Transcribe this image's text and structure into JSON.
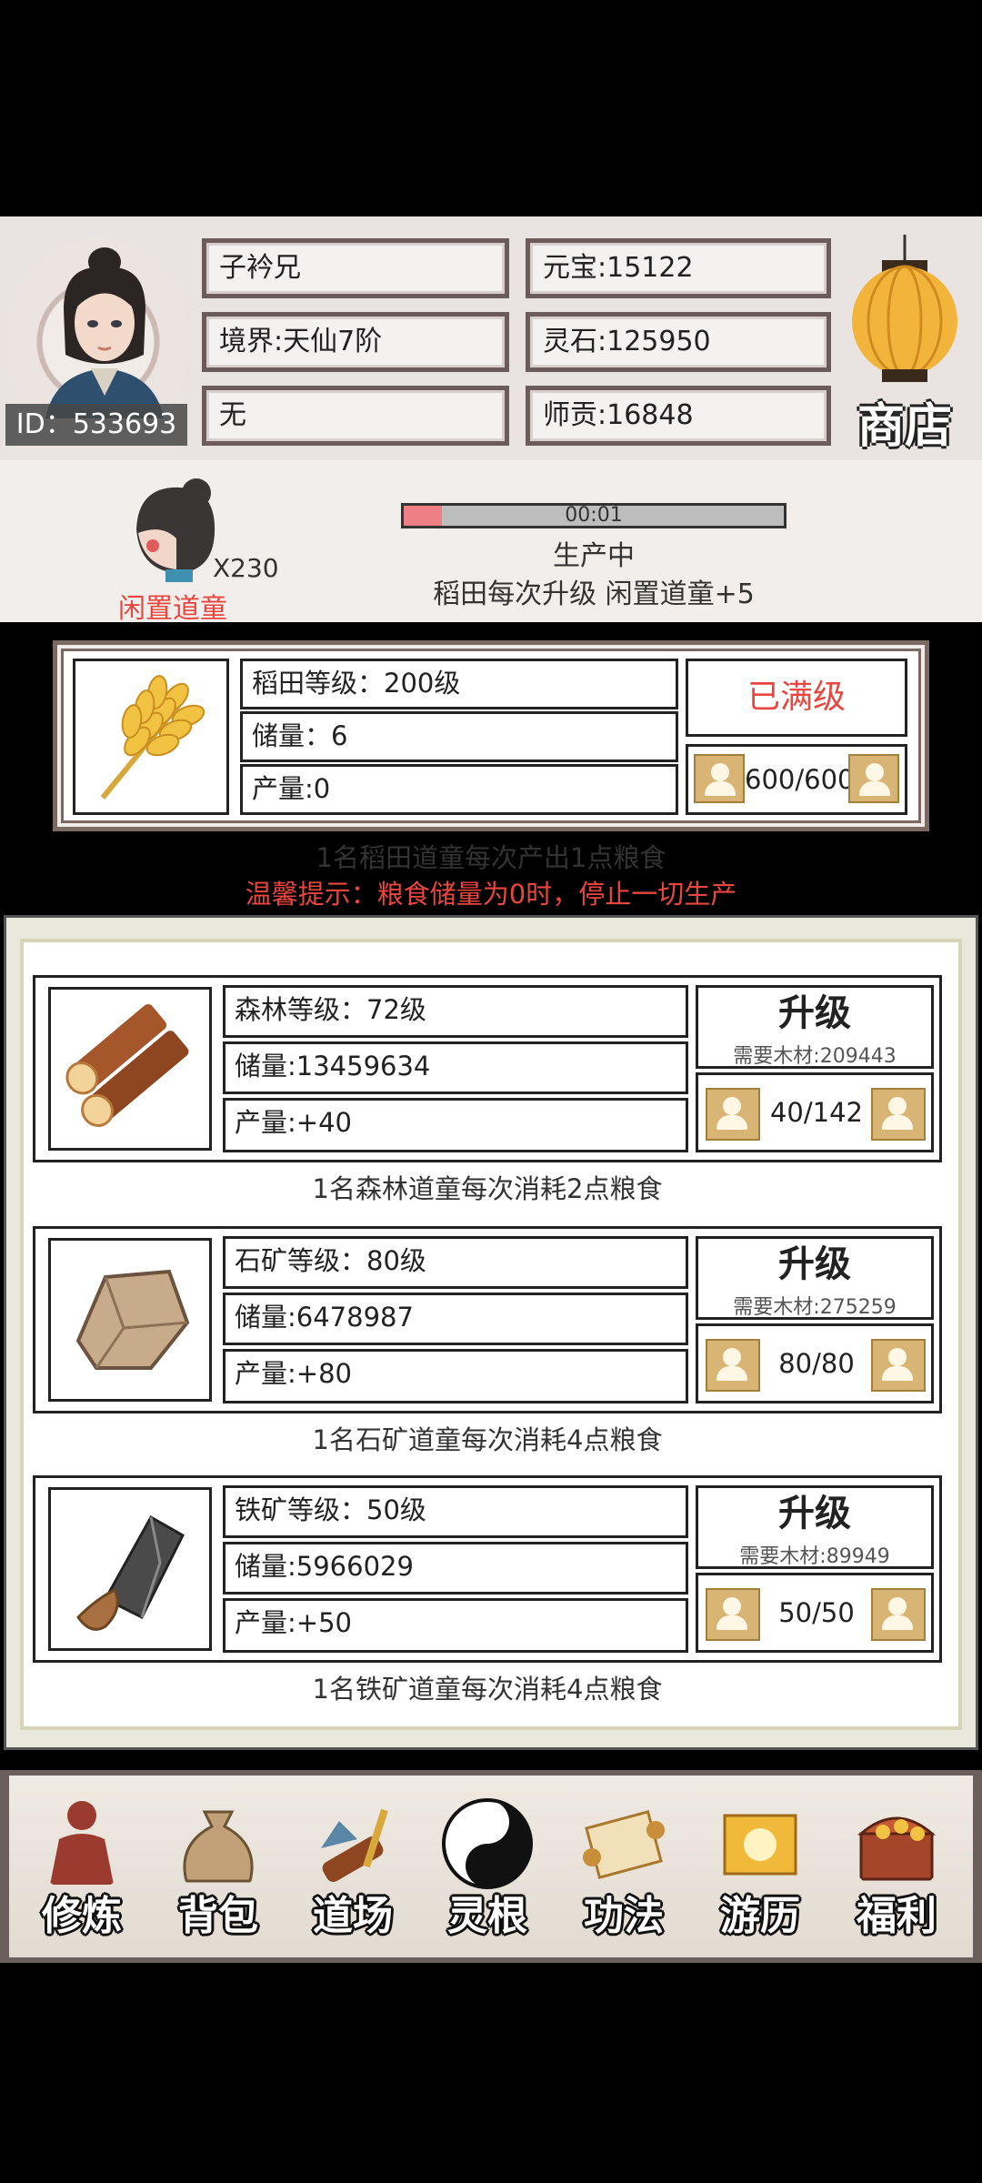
{
  "header": {
    "player_id": "ID：533693",
    "name": "子衿兄",
    "realm": "境界:天仙7阶",
    "sect": "无",
    "yuanbao": "元宝:15122",
    "spirit_stone": "灵石:125950",
    "mentor_contribution": "师贡:16848",
    "shop_label": "商店"
  },
  "idle": {
    "count": "X230",
    "label": "闲置道童",
    "timer": "00:01",
    "progress_fraction": 0.1,
    "status": "生产中",
    "hint": "稻田每次升级 闲置道童+5"
  },
  "paddy": {
    "level": "稻田等级：200级",
    "stock": "储量：6",
    "output": "产量:0",
    "maxed": "已满级",
    "workers": "600/600",
    "note": "1名稻田道童每次产出1点粮食",
    "warning": "温馨提示：粮食储量为0时，停止一切生产"
  },
  "resources": [
    {
      "level": "森林等级：72级",
      "stock": "储量:13459634",
      "output": "产量:+40",
      "upgrade": "升级",
      "need": "需要木材:209443",
      "workers": "40/142",
      "note": "1名森林道童每次消耗2点粮食"
    },
    {
      "level": "石矿等级：80级",
      "stock": "储量:6478987",
      "output": "产量:+80",
      "upgrade": "升级",
      "need": "需要木材:275259",
      "workers": "80/80",
      "note": "1名石矿道童每次消耗4点粮食"
    },
    {
      "level": "铁矿等级：50级",
      "stock": "储量:5966029",
      "output": "产量:+50",
      "upgrade": "升级",
      "need": "需要木材:89949",
      "workers": "50/50",
      "note": "1名铁矿道童每次消耗4点粮食"
    }
  ],
  "nav": [
    "修炼",
    "背包",
    "道场",
    "灵根",
    "功法",
    "游历",
    "福利"
  ],
  "colors": {
    "red": "#e8463f",
    "progress_fill": "#ee8085",
    "worker_button": "#d8b574"
  }
}
